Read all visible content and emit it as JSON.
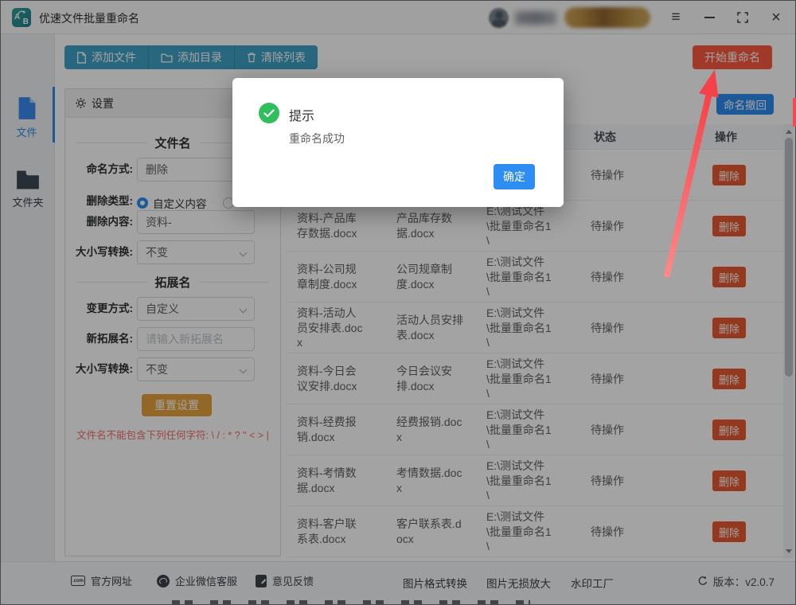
{
  "titlebar": {
    "title": "优速文件批量重命名",
    "logo_a": "A",
    "logo_b": "B",
    "menu_glyph": "≡",
    "close_glyph": "×"
  },
  "sidebar": {
    "items": [
      {
        "label": "文件",
        "active": true
      },
      {
        "label": "文件夹",
        "active": false
      }
    ]
  },
  "toolbar": {
    "add_file": "添加文件",
    "add_dir": "添加目录",
    "clear_list": "清除列表",
    "start_rename": "开始重命名",
    "undo_rename": "命名撤回"
  },
  "settings": {
    "header": "设置",
    "section_filename": "文件名",
    "naming_label": "命名方式:",
    "naming_value": "删除",
    "delete_type_label": "删除类型:",
    "delete_type_option1": "自定义内容",
    "delete_content_label": "删除内容:",
    "delete_content_value": "资料-",
    "case_label": "大小写转换:",
    "case_value": "不变",
    "section_ext": "拓展名",
    "change_label": "变更方式:",
    "change_value": "自定义",
    "new_ext_label": "新拓展名:",
    "new_ext_placeholder": "请输入新拓展名",
    "case2_label": "大小写转换:",
    "case2_value": "不变",
    "reset_button": "重置设置",
    "warning": "文件名不能包含下列任何字符: \\ / : * ? \" < > |"
  },
  "table": {
    "headers": {
      "status": "状态",
      "action": "操作"
    },
    "rows": [
      {
        "old": "",
        "new": "",
        "path": "",
        "status": "待操作",
        "action": "删除"
      },
      {
        "old": "资料-产品库存数据.docx",
        "new": "产品库存数据.docx",
        "path": "E:\\测试文件\\批量重命名1\\",
        "status": "待操作",
        "action": "删除"
      },
      {
        "old": "资料-公司规章制度.docx",
        "new": "公司规章制度.docx",
        "path": "E:\\测试文件\\批量重命名1\\",
        "status": "待操作",
        "action": "删除"
      },
      {
        "old": "资料-活动人员安排表.docx",
        "new": "活动人员安排表.docx",
        "path": "E:\\测试文件\\批量重命名1\\",
        "status": "待操作",
        "action": "删除"
      },
      {
        "old": "资料-今日会议安排.docx",
        "new": "今日会议安排.docx",
        "path": "E:\\测试文件\\批量重命名1\\",
        "status": "待操作",
        "action": "删除"
      },
      {
        "old": "资料-经费报销.docx",
        "new": "经费报销.docx",
        "path": "E:\\测试文件\\批量重命名1\\",
        "status": "待操作",
        "action": "删除"
      },
      {
        "old": "资料-考情数据.docx",
        "new": "考情数据.docx",
        "path": "E:\\测试文件\\批量重命名1\\",
        "status": "待操作",
        "action": "删除"
      },
      {
        "old": "资料-客户联系表.docx",
        "new": "客户联系表.docx",
        "path": "E:\\测试文件\\批量重命名1\\",
        "status": "待操作",
        "action": "删除"
      }
    ]
  },
  "modal": {
    "title": "提示",
    "message": "重命名成功",
    "ok_button": "确定"
  },
  "footer": {
    "official_site": "官方网址",
    "wechat_support": "企业微信客服",
    "feedback": "意见反馈",
    "tool1": "图片格式转换",
    "tool2": "图片无损放大",
    "tool3": "水印工厂",
    "version": "版本：v2.0.7"
  },
  "colors": {
    "teal_button": "#3fa2c6",
    "red_button": "#fa5a40",
    "row_delete_button": "#e85a33",
    "primary_blue": "#2d8cf0",
    "gold_button": "#e6a23c",
    "success_green": "#2fbf5d",
    "warning_text": "#f56c6c",
    "annotation_arrow": "#f5424a"
  }
}
